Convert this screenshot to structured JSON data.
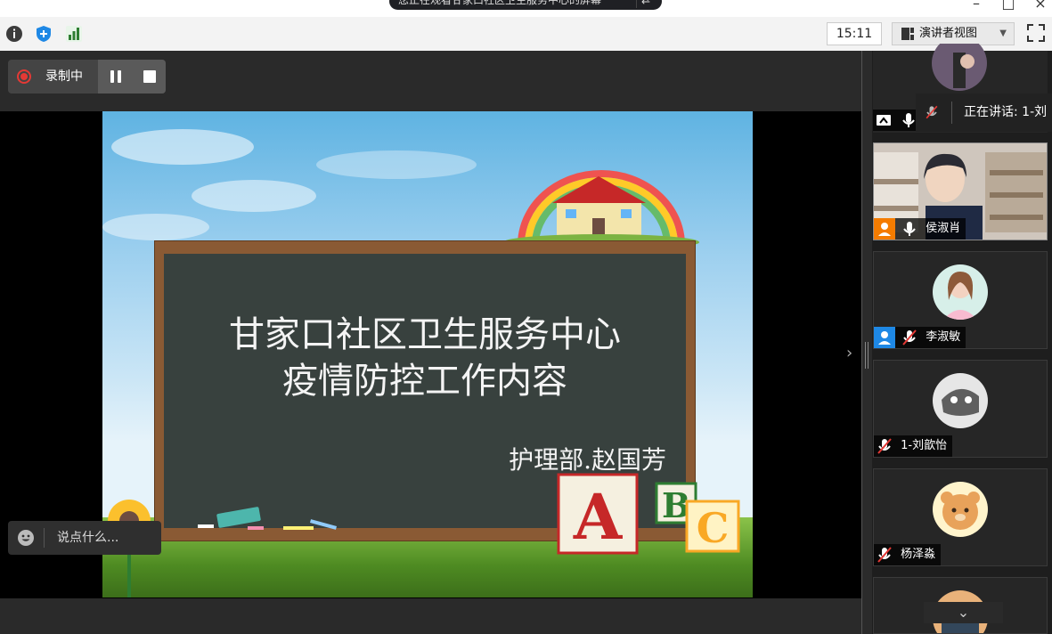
{
  "window": {
    "title": "您正在观看甘家口社区卫生服务中心的屏幕",
    "title_button": "⇄"
  },
  "toolbar": {
    "clock": "15:11",
    "view_selector": "演讲者视图"
  },
  "recording": {
    "label": "录制中"
  },
  "slide": {
    "title_line1": "甘家口社区卫生服务中心",
    "title_line2": "疫情防控工作内容",
    "author": "护理部.赵国芳"
  },
  "chat": {
    "placeholder": "说点什么..."
  },
  "speaking_banner": {
    "text": "正在讲话: 1-刘"
  },
  "participants": [
    {
      "name": "侯淑肖",
      "muted": false,
      "video": true
    },
    {
      "name": "李淑敏",
      "muted": true,
      "video": false
    },
    {
      "name": "1-刘歆怡",
      "muted": true,
      "video": false
    },
    {
      "name": "杨泽淼",
      "muted": true,
      "video": false
    }
  ],
  "colors": {
    "recording_red": "#e53935",
    "accent_blue": "#1e88e5",
    "signal_green": "#2e7d32",
    "avatar_orange": "#f57c00"
  }
}
